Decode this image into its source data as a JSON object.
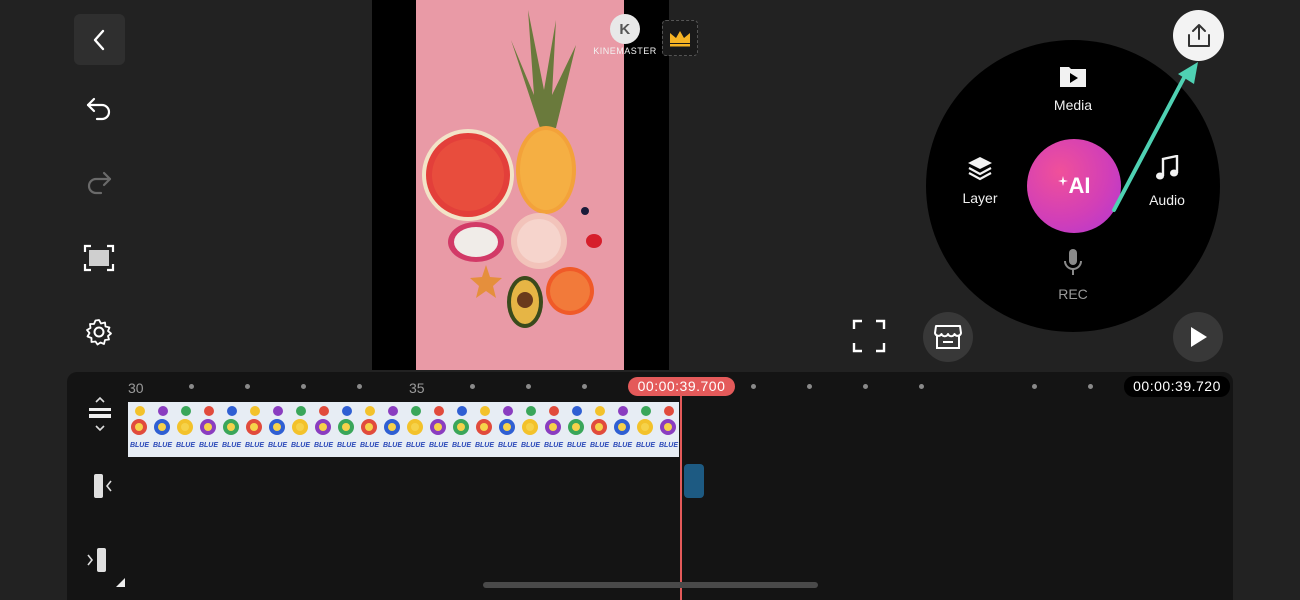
{
  "left_toolbar": {
    "back_icon": "chevron-left-icon",
    "undo_icon": "undo-icon",
    "redo_icon": "redo-icon",
    "capture_icon": "capture-frame-icon",
    "settings_icon": "gear-icon"
  },
  "preview": {
    "watermark_text": "KINEMASTER",
    "watermark_logo": "K"
  },
  "wheel": {
    "media_label": "Media",
    "layer_label": "Layer",
    "audio_label": "Audio",
    "rec_label": "REC",
    "ai_label": "AI"
  },
  "timeline": {
    "ruler_labels": [
      "30",
      "35"
    ],
    "current_time": "00:00:39.700",
    "end_time": "00:00:39.720",
    "clip_frame_text": "BLUE"
  },
  "colors": {
    "accent_red": "#e45a5a",
    "ai_gradient_start": "#f0509a",
    "ai_gradient_end": "#b037d4",
    "arrow_color": "#4fd1b3"
  }
}
